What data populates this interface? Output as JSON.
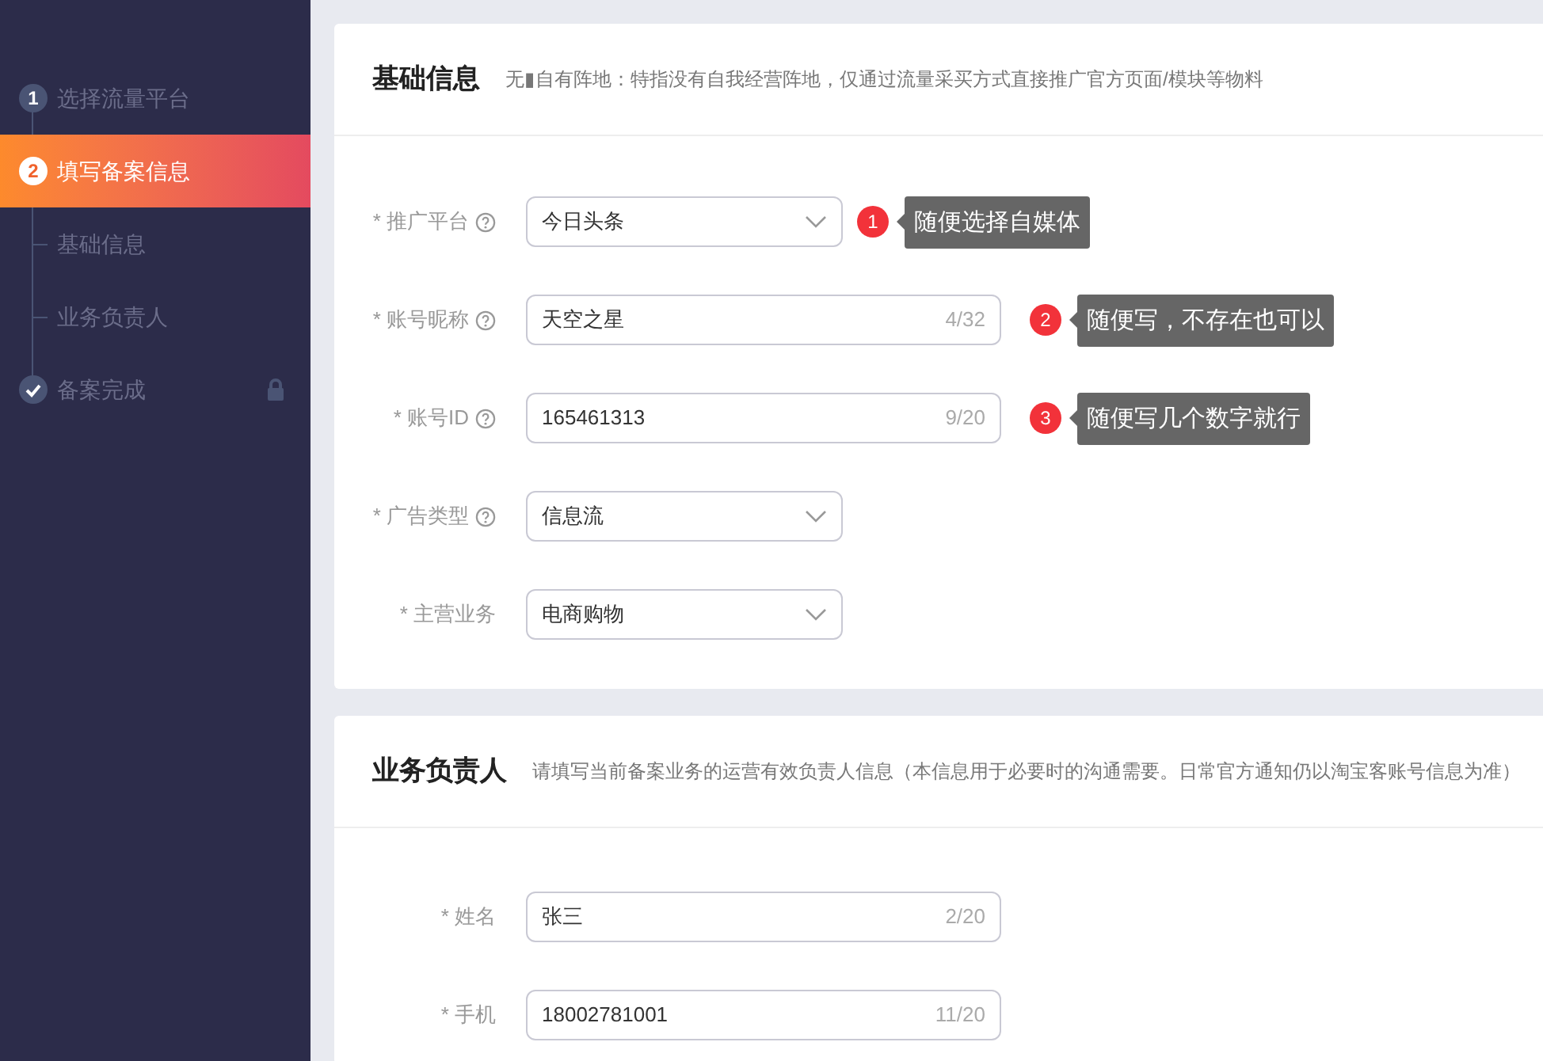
{
  "sidebar": {
    "steps": [
      {
        "kind": "step",
        "marker": "1",
        "label": "选择流量平台",
        "selected": false
      },
      {
        "kind": "step",
        "marker": "2",
        "label": "填写备案信息",
        "selected": true
      },
      {
        "kind": "sub",
        "label": "基础信息",
        "selected": false
      },
      {
        "kind": "sub",
        "label": "业务负责人",
        "selected": false
      },
      {
        "kind": "done",
        "label": "备案完成",
        "selected": false,
        "locked": true
      }
    ]
  },
  "sections": [
    {
      "title": "基础信息",
      "description": "无▮自有阵地：特指没有自我经营阵地，仅通过流量采买方式直接推广官方页面/模块等物料",
      "fields": [
        {
          "kind": "select",
          "label": "* 推广平台",
          "help": true,
          "value": "今日头条",
          "note": {
            "number": "1",
            "text": "随便选择自媒体"
          }
        },
        {
          "kind": "input",
          "label": "* 账号昵称",
          "help": true,
          "value": "天空之星",
          "count": "4/32",
          "note": {
            "number": "2",
            "text": "随便写，不存在也可以"
          }
        },
        {
          "kind": "input",
          "label": "* 账号ID",
          "help": true,
          "value": "165461313",
          "count": "9/20",
          "note": {
            "number": "3",
            "text": "随便写几个数字就行"
          }
        },
        {
          "kind": "select",
          "label": "* 广告类型",
          "help": true,
          "value": "信息流"
        },
        {
          "kind": "select",
          "label": "* 主营业务",
          "help": false,
          "value": "电商购物"
        }
      ]
    },
    {
      "title": "业务负责人",
      "description": "请填写当前备案业务的运营有效负责人信息（本信息用于必要时的沟通需要。日常官方通知仍以淘宝客账号信息为准）",
      "fields": [
        {
          "kind": "input",
          "label": "* 姓名",
          "help": false,
          "value": "张三",
          "count": "2/20"
        },
        {
          "kind": "input",
          "label": "* 手机",
          "help": false,
          "value": "18002781001",
          "count": "11/20"
        }
      ]
    }
  ]
}
